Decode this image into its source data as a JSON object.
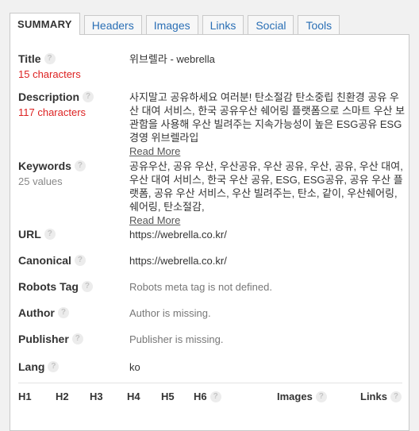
{
  "tabs": [
    "SUMMARY",
    "Headers",
    "Images",
    "Links",
    "Social",
    "Tools"
  ],
  "rows": {
    "title": {
      "label": "Title",
      "sub": "15 characters",
      "value": "위브렐라 - webrella"
    },
    "description": {
      "label": "Description",
      "sub": "117 characters",
      "value": "사지말고 공유하세요 여러분! 탄소절감 탄소중립 친환경 공유 우산 대여 서비스, 한국 공유우산 쉐어링 플랫폼으로 스마트 우산 보관함을 사용해 우산 빌려주는 지속가능성이 높은 ESG공유 ESG경영 위브렐라입",
      "read_more": "Read More"
    },
    "keywords": {
      "label": "Keywords",
      "sub": "25 values",
      "value": "공유우산, 공유 우산, 우산공유, 우산 공유, 우산, 공유, 우산 대여, 우산 대여 서비스, 한국 우산 공유, ESG, ESG공유, 공유 우산 플랫폼, 공유 우산 서비스, 우산 빌려주는, 탄소, 같이, 우산쉐어링, 쉐어링, 탄소절감,",
      "read_more": "Read More"
    },
    "url": {
      "label": "URL",
      "value": "https://webrella.co.kr/"
    },
    "canonical": {
      "label": "Canonical",
      "value": "https://webrella.co.kr/"
    },
    "robots": {
      "label": "Robots Tag",
      "value": "Robots meta tag is not defined."
    },
    "author": {
      "label": "Author",
      "value": "Author is missing."
    },
    "publisher": {
      "label": "Publisher",
      "value": "Publisher is missing."
    },
    "lang": {
      "label": "Lang",
      "value": "ko"
    }
  },
  "headers": {
    "h1": "H1",
    "h2": "H2",
    "h3": "H3",
    "h4": "H4",
    "h5": "H5",
    "h6": "H6",
    "images": "Images",
    "links": "Links"
  },
  "help_glyph": "?"
}
